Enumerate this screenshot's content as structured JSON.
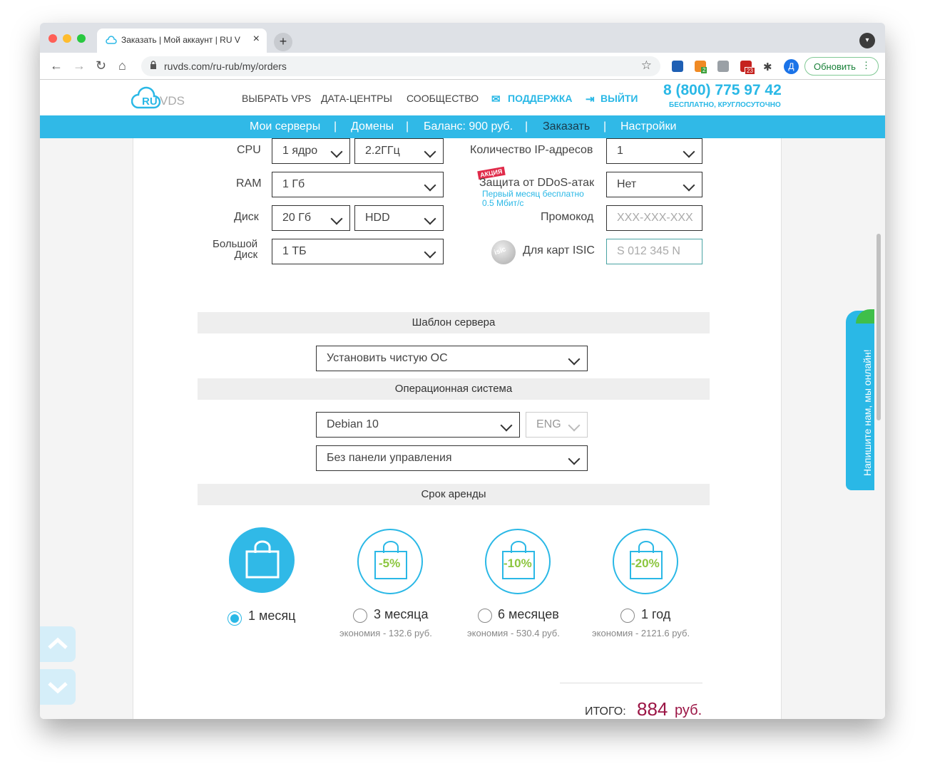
{
  "browser": {
    "tab_title": "Заказать | Мой аккаунт | RU V",
    "url": "ruvds.com/ru-rub/my/orders",
    "update_label": "Обновить",
    "avatar_letter": "Д",
    "ext_badge_download": "2",
    "ext_badge_mail": "23"
  },
  "header": {
    "logo_ru": "RU",
    "logo_vds": "VDS",
    "nav": [
      "ВЫБРАТЬ VPS",
      "ДАТА-ЦЕНТРЫ",
      "СООБЩЕСТВО",
      "ПОДДЕРЖКА",
      "ВЫЙТИ"
    ],
    "phone": "8 (800) 775 97 42",
    "phone_sub": "БЕСПЛАТНО, КРУГЛОСУТОЧНО"
  },
  "subnav": {
    "items": [
      "Мои серверы",
      "Домены",
      "Баланс: 900 руб.",
      "Заказать",
      "Настройки"
    ],
    "separator": "|",
    "active": "Заказать"
  },
  "config": {
    "cpu_label": "CPU",
    "cpu_cores": "1 ядро",
    "cpu_freq": "2.2ГГц",
    "ram_label": "RAM",
    "ram_value": "1 Гб",
    "disk_label": "Диск",
    "disk_size": "20 Гб",
    "disk_type": "HDD",
    "bigdisk_label_1": "Большой",
    "bigdisk_label_2": "Диск",
    "bigdisk_value": "1 ТБ",
    "ip_label": "Количество IP-адресов",
    "ip_value": "1",
    "promo_badge": "АКЦИЯ",
    "ddos_label": "Защита от DDoS-атак",
    "ddos_note_1": "Первый месяц бесплатно",
    "ddos_note_2": "0.5 Мбит/с",
    "ddos_value": "Нет",
    "promocode_label": "Промокод",
    "promocode_placeholder": "XXX-XXX-XXX",
    "isic_icon_text": "isic",
    "isic_label": "Для карт ISIC",
    "isic_placeholder": "S 012 345 N"
  },
  "template": {
    "title": "Шаблон сервера",
    "value": "Установить чистую ОС"
  },
  "os": {
    "title": "Операционная система",
    "value": "Debian 10",
    "lang": "ENG",
    "panel": "Без панели управления"
  },
  "rent": {
    "title": "Срок аренды",
    "options": [
      {
        "label": "1 месяц",
        "discount": "",
        "saving": "",
        "selected": true
      },
      {
        "label": "3 месяца",
        "discount": "-5%",
        "saving": "экономия - 132.6 руб.",
        "selected": false
      },
      {
        "label": "6 месяцев",
        "discount": "-10%",
        "saving": "экономия - 530.4 руб.",
        "selected": false
      },
      {
        "label": "1 год",
        "discount": "-20%",
        "saving": "экономия - 2121.6 руб.",
        "selected": false
      }
    ]
  },
  "total": {
    "label": "ИТОГО:",
    "amount": "884",
    "currency": "руб."
  },
  "chat": {
    "label": "Напишите нам, мы онлайн!"
  },
  "colors": {
    "accent": "#30b9e7",
    "total": "#9b1545",
    "discount": "#8cc63f"
  }
}
